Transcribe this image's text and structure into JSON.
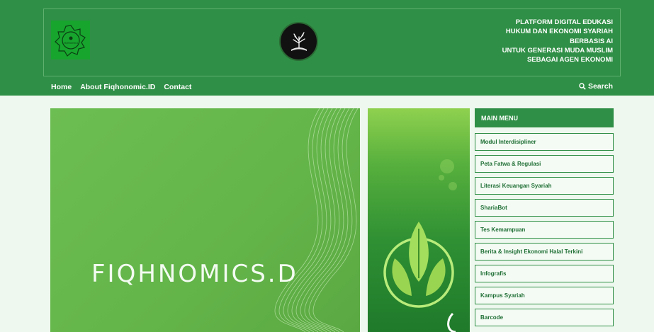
{
  "header": {
    "tagline_lines": [
      "PLATFORM DIGITAL EDUKASI",
      "HUKUM DAN EKONOMI SYARIAH",
      "BERBASIS AI",
      "UNTUK GENERASI MUDA MUSLIM",
      "SEBAGAI AGEN EKONOMI"
    ],
    "logo_left_text": "FIQHNOMICS"
  },
  "nav": {
    "items": [
      "Home",
      "About Fiqhonomic.ID",
      "Contact"
    ],
    "search_label": "Search"
  },
  "hero": {
    "title": "FIQHNOMICS.D"
  },
  "menu": {
    "title": "MAIN MENU",
    "items": [
      "Modul Interdisipliner",
      "Peta Fatwa & Regulasi",
      "Literasi Keuangan Syariah",
      "ShariaBot",
      "Tes Kemampuan",
      "Berita & Insight Ekonomi Halal Terkini",
      "Infografis",
      "Kampus Syariah",
      "Barcode"
    ]
  },
  "colors": {
    "brand_green": "#2f8f46",
    "page_bg": "#eef8ee",
    "hero_green": "#6cbd52"
  },
  "icons": {
    "search": "search-icon",
    "logo_left": "fiqhnomics-logo-icon",
    "logo_center": "tree-logo-icon"
  }
}
